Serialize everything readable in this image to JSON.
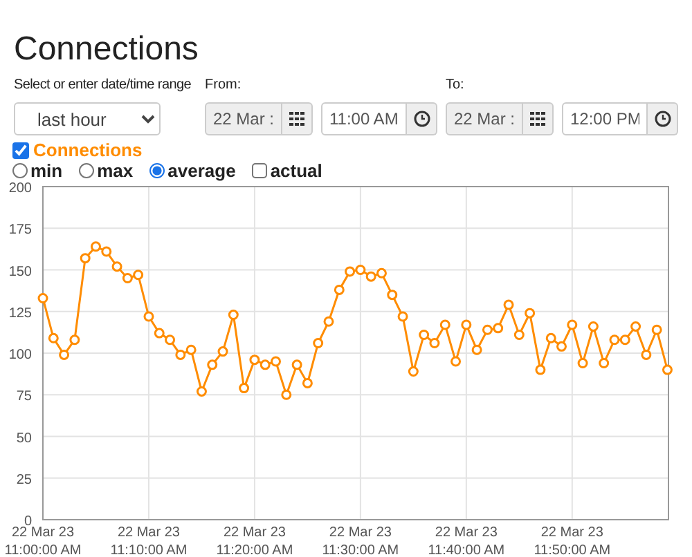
{
  "title": "Connections",
  "range": {
    "label": "Select or enter date/time range",
    "value": "last hour"
  },
  "from": {
    "label": "From:",
    "date": {
      "value": "22 Mar :",
      "disabled": true
    },
    "time": {
      "value": "11:00 AM",
      "disabled": false
    }
  },
  "to": {
    "label": "To:",
    "date": {
      "value": "22 Mar :",
      "disabled": true
    },
    "time": {
      "value": "12:00 PM",
      "disabled": false
    }
  },
  "series_toggle": {
    "checked": true
  },
  "modes": [
    {
      "kind": "radio",
      "label": "min",
      "selected": false
    },
    {
      "kind": "radio",
      "label": "max",
      "selected": false
    },
    {
      "kind": "radio",
      "label": "average",
      "selected": true
    },
    {
      "kind": "checkbox",
      "label": "actual",
      "selected": false
    }
  ],
  "chart_data": {
    "type": "line",
    "categories": [
      "22 Mar 23\n11:00:00 AM",
      null,
      null,
      null,
      null,
      null,
      null,
      null,
      null,
      null,
      "22 Mar 23\n11:10:00 AM",
      null,
      null,
      null,
      null,
      null,
      null,
      null,
      null,
      null,
      "22 Mar 23\n11:20:00 AM",
      null,
      null,
      null,
      null,
      null,
      null,
      null,
      null,
      null,
      "22 Mar 23\n11:30:00 AM",
      null,
      null,
      null,
      null,
      null,
      null,
      null,
      null,
      null,
      "22 Mar 23\n11:40:00 AM",
      null,
      null,
      null,
      null,
      null,
      null,
      null,
      null,
      null,
      "22 Mar 23\n11:50:00 AM",
      null,
      null,
      null,
      null,
      null,
      null,
      null,
      null,
      null
    ],
    "grid": true,
    "series": [
      {
        "name": "Connections",
        "color": "#ff8c00",
        "marker": "circle",
        "values": [
          133,
          109,
          99,
          108,
          157,
          164,
          161,
          152,
          145,
          147,
          122,
          112,
          108,
          99,
          102,
          77,
          93,
          101,
          123,
          79,
          96,
          93,
          95,
          75,
          93,
          82,
          106,
          119,
          138,
          149,
          150,
          146,
          148,
          135,
          122,
          89,
          111,
          106,
          117,
          95,
          117,
          102,
          114,
          115,
          129,
          111,
          124,
          90,
          109,
          104,
          117,
          94,
          116,
          94,
          108,
          108,
          116,
          99,
          114,
          90
        ]
      }
    ],
    "ylim": [
      0,
      200
    ],
    "yticks": [
      0,
      25,
      50,
      75,
      100,
      125,
      150,
      175,
      200
    ]
  }
}
